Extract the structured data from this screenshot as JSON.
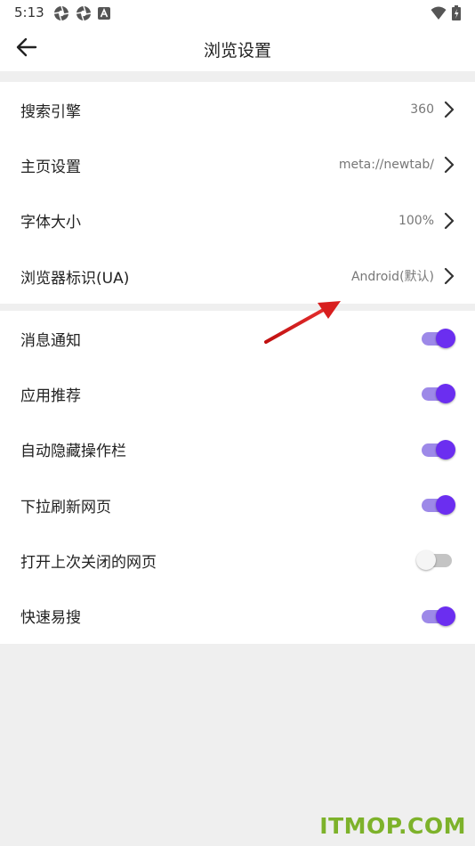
{
  "status_bar": {
    "time": "5:13",
    "left_icons": [
      "aperture-icon",
      "aperture-icon",
      "a-badge-icon"
    ],
    "right_icons": [
      "wifi-icon",
      "battery-icon"
    ]
  },
  "app_bar": {
    "back_icon": "arrow-left-icon",
    "title": "浏览设置"
  },
  "nav_section": {
    "items": [
      {
        "label": "搜索引擎",
        "value": "360"
      },
      {
        "label": "主页设置",
        "value": "meta://newtab/"
      },
      {
        "label": "字体大小",
        "value": "100%"
      },
      {
        "label": "浏览器标识(UA)",
        "value": "Android(默认)"
      }
    ]
  },
  "toggle_section": {
    "items": [
      {
        "label": "消息通知",
        "enabled": true
      },
      {
        "label": "应用推荐",
        "enabled": true
      },
      {
        "label": "自动隐藏操作栏",
        "enabled": true
      },
      {
        "label": "下拉刷新网页",
        "enabled": true
      },
      {
        "label": "打开上次关闭的网页",
        "enabled": false
      },
      {
        "label": "快速易搜",
        "enabled": true
      }
    ]
  },
  "colors": {
    "accent": "#6b2ef0",
    "accent_track": "#9d89e8",
    "annotation_arrow": "#d81e1e",
    "watermark": "#7db22a"
  },
  "watermark": "ITMOP.COM"
}
